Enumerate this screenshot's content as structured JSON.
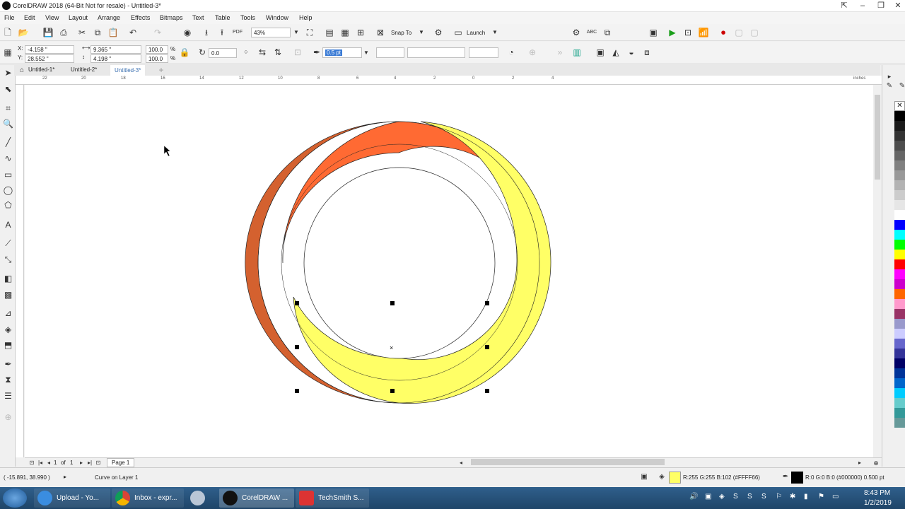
{
  "titlebar": {
    "title": "CorelDRAW 2018 (64-Bit Not for resale) - Untitled-3*"
  },
  "menu": [
    "File",
    "Edit",
    "View",
    "Layout",
    "Arrange",
    "Effects",
    "Bitmaps",
    "Text",
    "Table",
    "Tools",
    "Window",
    "Help"
  ],
  "standard_toolbar": {
    "zoom": "43%",
    "snap_to": "Snap To",
    "launch": "Launch"
  },
  "property_bar": {
    "x": "-4.158 \"",
    "y": "28.552 \"",
    "width": "9.365 \"",
    "height": "4.198 \"",
    "scale_x": "100.0",
    "scale_y": "100.0",
    "pct": "%",
    "rotation": "0.0",
    "outline_width": "0.5 pt"
  },
  "doc_tabs": [
    "Untitled-1*",
    "Untitled-2*",
    "Untitled-3*"
  ],
  "ruler_h_numbers": [
    "22",
    "20",
    "18",
    "16",
    "14",
    "12",
    "10",
    "8",
    "6",
    "4",
    "2",
    "0",
    "2",
    "4"
  ],
  "ruler_unit": "inches",
  "page_nav": {
    "current": "1",
    "of": "of",
    "total": "1",
    "page_tab": "Page 1"
  },
  "status": {
    "coords": "( -15.891, 38.990 )",
    "object": "Curve on Layer 1",
    "fill": "R:255 G:255 B:102 (#FFFF66)",
    "outline": "R:0 G:0 B:0 (#000000)  0.500 pt"
  },
  "colors": {
    "orange": "#ff6a33",
    "dark_orange": "#d4612f",
    "yellow": "#ffff66"
  },
  "palette": [
    "#000000",
    "#1a1a1a",
    "#333333",
    "#4d4d4d",
    "#666666",
    "#808080",
    "#999999",
    "#b3b3b3",
    "#cccccc",
    "#e6e6e6",
    "#ffffff",
    "#0000ff",
    "#00ffff",
    "#00ff00",
    "#ffff00",
    "#ff0000",
    "#ff00ff",
    "#cc00cc",
    "#ff6600",
    "#ff99cc",
    "#993366",
    "#9999cc",
    "#ccccff",
    "#6666cc",
    "#333399",
    "#000066",
    "#003399",
    "#0066cc",
    "#00ccff",
    "#66cccc",
    "#339999",
    "#669999"
  ],
  "taskbar": {
    "tasks": [
      "Upload - Yo...",
      "Inbox - expr...",
      "",
      "CorelDRAW ...",
      "TechSmith S..."
    ],
    "time": "8:43 PM",
    "date": "1/2/2019"
  }
}
